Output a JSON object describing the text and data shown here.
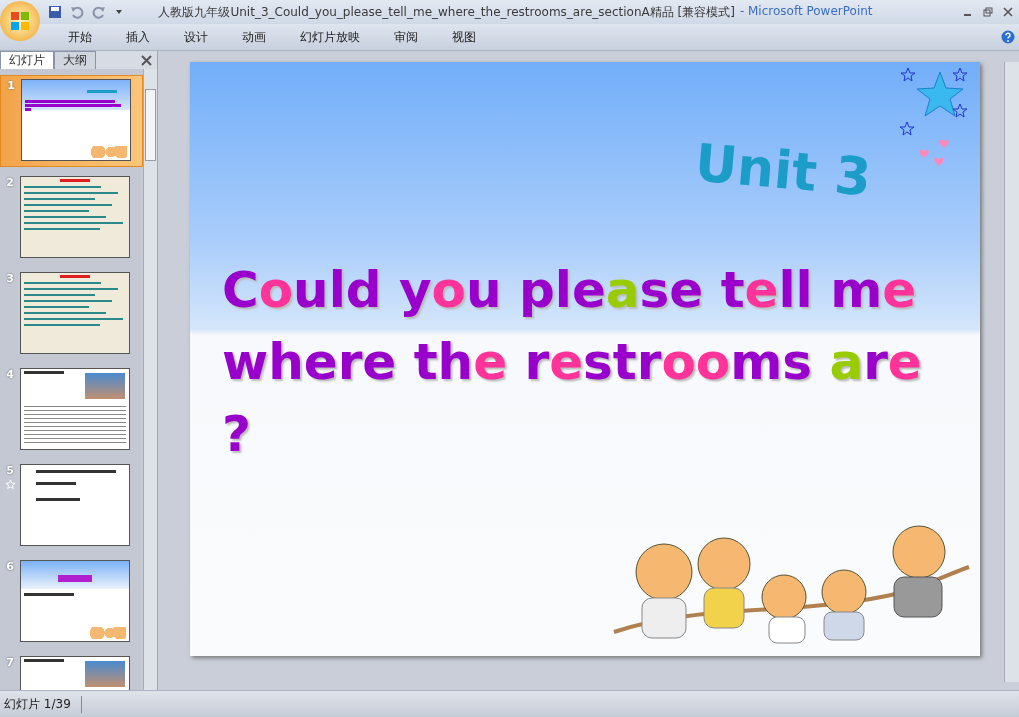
{
  "window": {
    "title": "人教版九年级Unit_3_Could_you_please_tell_me_where_the_restrooms_are_sectionA精品 [兼容模式]",
    "app": "- Microsoft PowerPoint"
  },
  "ribbon_tabs": [
    {
      "label": "开始",
      "selected": false
    },
    {
      "label": "插入",
      "selected": false
    },
    {
      "label": "设计",
      "selected": false
    },
    {
      "label": "动画",
      "selected": false
    },
    {
      "label": "幻灯片放映",
      "selected": false
    },
    {
      "label": "审阅",
      "selected": false
    },
    {
      "label": "视图",
      "selected": false
    }
  ],
  "panel_tabs": [
    {
      "label": "幻灯片",
      "selected": true
    },
    {
      "label": "大纲",
      "selected": false
    }
  ],
  "thumbnails": [
    {
      "number": "1",
      "selected": true,
      "has_animation": false,
      "kind": "title"
    },
    {
      "number": "2",
      "selected": false,
      "has_animation": false,
      "kind": "exercise"
    },
    {
      "number": "3",
      "selected": false,
      "has_animation": false,
      "kind": "exercise"
    },
    {
      "number": "4",
      "selected": false,
      "has_animation": false,
      "kind": "dialogue"
    },
    {
      "number": "5",
      "selected": false,
      "has_animation": true,
      "kind": "questions"
    },
    {
      "number": "6",
      "selected": false,
      "has_animation": false,
      "kind": "pair"
    },
    {
      "number": "7",
      "selected": false,
      "has_animation": false,
      "kind": "dialogue"
    }
  ],
  "slide": {
    "unit": "Unit 3",
    "title_lines": [
      [
        {
          "text": "C",
          "color": "#9900cc"
        },
        {
          "text": "o",
          "color": "#ff3399"
        },
        {
          "text": "uld y",
          "color": "#9900cc"
        },
        {
          "text": "o",
          "color": "#ff3399"
        },
        {
          "text": "u ple",
          "color": "#9900cc"
        },
        {
          "text": "a",
          "color": "#99cc00"
        },
        {
          "text": "se t",
          "color": "#9900cc"
        },
        {
          "text": "e",
          "color": "#ff3399"
        },
        {
          "text": "ll m",
          "color": "#9900cc"
        },
        {
          "text": "e",
          "color": "#ff3399"
        }
      ],
      [
        {
          "text": "where th",
          "color": "#9900cc"
        },
        {
          "text": "e",
          "color": "#ff3399"
        },
        {
          "text": " r",
          "color": "#9900cc"
        },
        {
          "text": "e",
          "color": "#ff3399"
        },
        {
          "text": "str",
          "color": "#9900cc"
        },
        {
          "text": "oo",
          "color": "#ff3399"
        },
        {
          "text": "ms ",
          "color": "#9900cc"
        },
        {
          "text": "a",
          "color": "#99cc00"
        },
        {
          "text": "r",
          "color": "#9900cc"
        },
        {
          "text": "e",
          "color": "#ff3399"
        }
      ],
      [
        {
          "text": "?",
          "color": "#9900cc"
        }
      ]
    ]
  },
  "status_bar": {
    "slide_counter": "幻灯片 1/39"
  }
}
